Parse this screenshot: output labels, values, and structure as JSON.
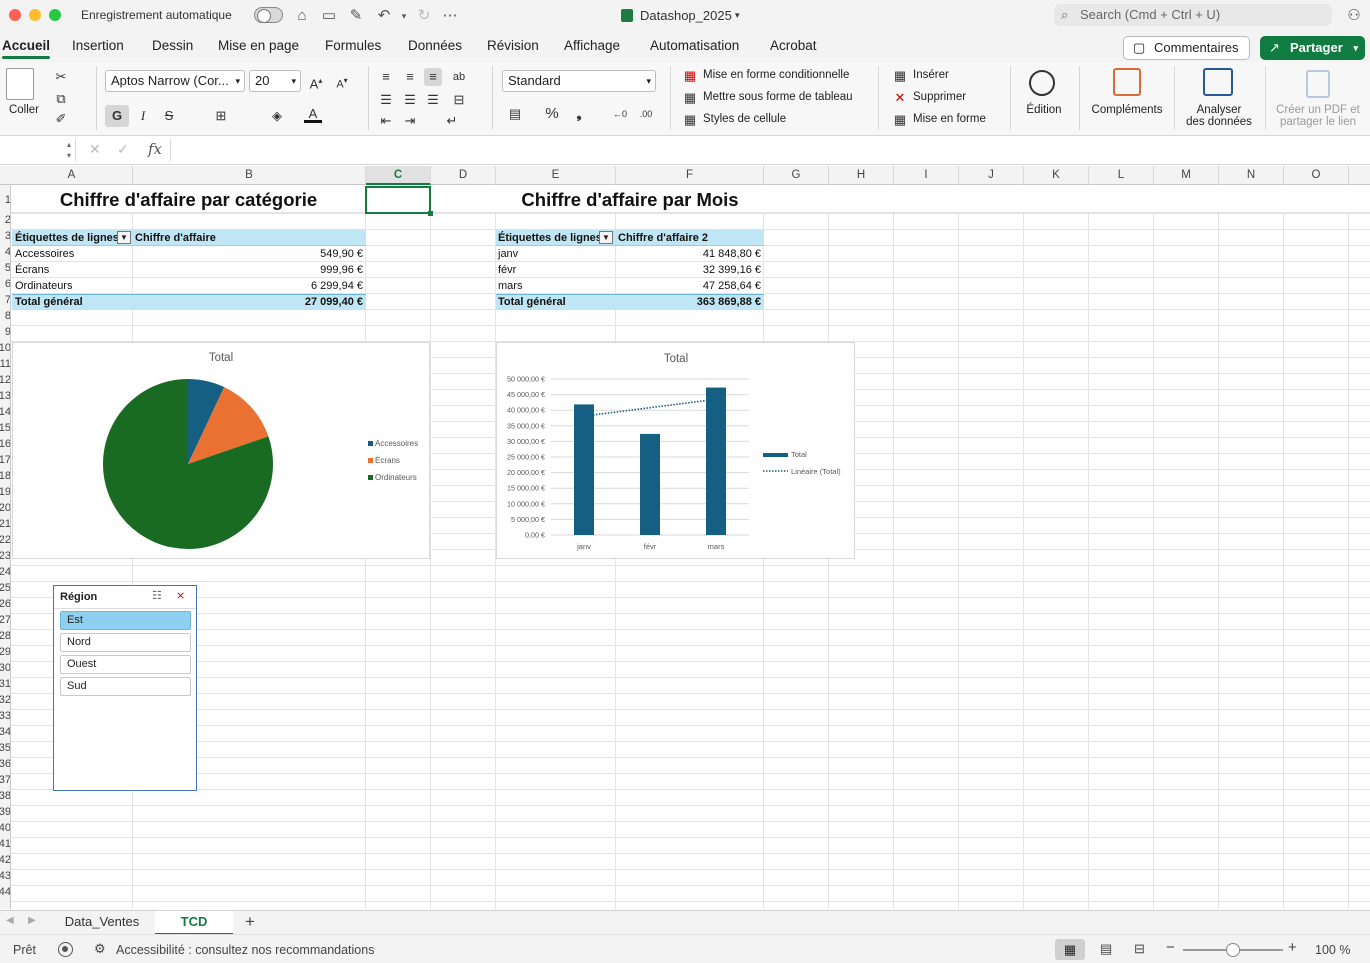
{
  "titlebar": {
    "autosave_label": "Enregistrement automatique",
    "doc_title": "Datashop_2025",
    "search_placeholder": "Search (Cmd + Ctrl + U)"
  },
  "tabs": [
    "Accueil",
    "Insertion",
    "Dessin",
    "Mise en page",
    "Formules",
    "Données",
    "Révision",
    "Affichage",
    "Automatisation",
    "Acrobat"
  ],
  "actions": {
    "comments": "Commentaires",
    "share": "Partager"
  },
  "ribbon": {
    "paste": "Coller",
    "font_name": "Aptos Narrow (Cor...",
    "font_size": "20",
    "bold": "G",
    "italic": "I",
    "strike": "S",
    "number_format": "Standard",
    "cond_format": "Mise en forme conditionnelle",
    "format_table": "Mettre sous forme de tableau",
    "cell_styles": "Styles de cellule",
    "insert": "Insérer",
    "delete": "Supprimer",
    "format": "Mise en forme",
    "edition": "Édition",
    "addins": "Compléments",
    "analyze_1": "Analyser",
    "analyze_2": "des données",
    "pdf_1": "Créer un PDF et",
    "pdf_2": "partager le lien"
  },
  "columns": [
    "A",
    "B",
    "C",
    "D",
    "E",
    "F",
    "G",
    "H",
    "I",
    "J",
    "K",
    "L",
    "M",
    "N",
    "O"
  ],
  "rows": [
    "1",
    "2",
    "3",
    "4",
    "5",
    "6",
    "7",
    "8",
    "9",
    "10",
    "11",
    "12",
    "13",
    "14",
    "15",
    "16",
    "17",
    "18",
    "19",
    "20",
    "21",
    "22",
    "23",
    "24",
    "25",
    "26",
    "27",
    "28",
    "29",
    "30",
    "31",
    "32",
    "33",
    "34",
    "35",
    "36",
    "37",
    "38",
    "39",
    "40",
    "41",
    "42",
    "43",
    "44"
  ],
  "pivot1": {
    "title": "Chiffre d'affaire par catégorie",
    "header_label": "Étiquettes de lignes",
    "header_value": "Chiffre d'affaire",
    "rows": [
      {
        "label": "Accessoires",
        "value": "549,90 €"
      },
      {
        "label": "Écrans",
        "value": "999,96 €"
      },
      {
        "label": "Ordinateurs",
        "value": "6 299,94 €"
      }
    ],
    "total_label": "Total général",
    "total_value": "27 099,40 €"
  },
  "pivot2": {
    "title": "Chiffre d'affaire par Mois",
    "header_label": "Étiquettes de lignes",
    "header_value": "Chiffre d'affaire 2",
    "rows": [
      {
        "label": "janv",
        "value": "41 848,80 €"
      },
      {
        "label": "févr",
        "value": "32 399,16 €"
      },
      {
        "label": "mars",
        "value": "47 258,64 €"
      }
    ],
    "total_label": "Total général",
    "total_value": "363 869,88 €"
  },
  "chart_data": [
    {
      "type": "pie",
      "title": "Total",
      "categories": [
        "Accessoires",
        "Écrans",
        "Ordinateurs"
      ],
      "values": [
        549.9,
        999.96,
        6299.94
      ],
      "colors": [
        "#156082",
        "#e97132",
        "#196b24"
      ],
      "legend": "right"
    },
    {
      "type": "bar",
      "title": "Total",
      "categories": [
        "janv",
        "févr",
        "mars"
      ],
      "series": [
        {
          "name": "Total",
          "values": [
            41848.8,
            32399.16,
            47258.64
          ],
          "color": "#156082"
        },
        {
          "name": "Linéaire (Total)",
          "values": [
            38100,
            40800,
            43500
          ],
          "color": "#156082",
          "style": "dotted"
        }
      ],
      "ylim": [
        0,
        50000
      ],
      "yticks": [
        "0,00 €",
        "5 000,00 €",
        "10 000,00 €",
        "15 000,00 €",
        "20 000,00 €",
        "25 000,00 €",
        "30 000,00 €",
        "35 000,00 €",
        "40 000,00 €",
        "45 000,00 €",
        "50 000,00 €"
      ],
      "legend": "right"
    }
  ],
  "slicer": {
    "title": "Région",
    "items": [
      {
        "label": "Est",
        "selected": true
      },
      {
        "label": "Nord",
        "selected": false
      },
      {
        "label": "Ouest",
        "selected": false
      },
      {
        "label": "Sud",
        "selected": false
      }
    ]
  },
  "sheets": [
    "Data_Ventes",
    "TCD"
  ],
  "status": {
    "ready": "Prêt",
    "accessibility": "Accessibilité : consultez nos recommandations",
    "zoom": "100 %"
  }
}
